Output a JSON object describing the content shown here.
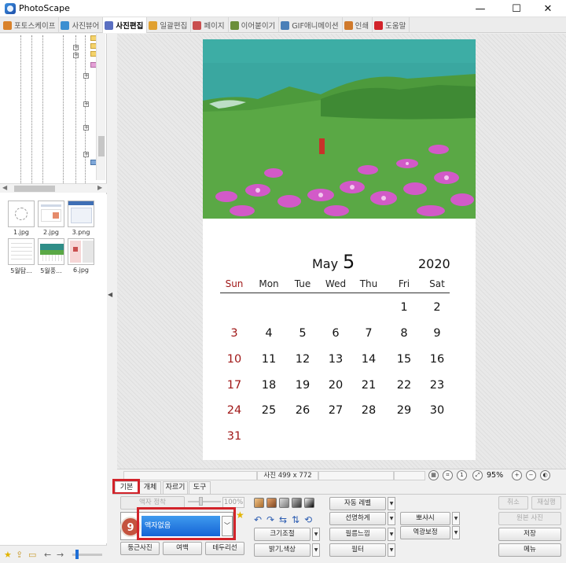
{
  "window": {
    "title": "PhotoScape",
    "controls": {
      "minimize": "—",
      "maximize": "☐",
      "close": "✕"
    }
  },
  "main_tabs": [
    {
      "label": "포토스케이프",
      "color": "#d9822b"
    },
    {
      "label": "사진뷰어",
      "color": "#3c8fd1"
    },
    {
      "label": "사진편집",
      "color": "#5a6fc2",
      "active": true
    },
    {
      "label": "일괄편집",
      "color": "#e0a030"
    },
    {
      "label": "페이지",
      "color": "#c94f4f"
    },
    {
      "label": "이어붙이기",
      "color": "#6b8e3a"
    },
    {
      "label": "GIF애니메이션",
      "color": "#4a7fb8"
    },
    {
      "label": "인쇄",
      "color": "#d07a2c"
    },
    {
      "label": "도움말",
      "color": "#d2232a"
    }
  ],
  "thumbnails": [
    {
      "caption": "1.jpg"
    },
    {
      "caption": "2.jpg"
    },
    {
      "caption": "3.png"
    },
    {
      "caption": "5월탐..."
    },
    {
      "caption": "5월풍..."
    },
    {
      "caption": "6.jpg"
    }
  ],
  "calendar": {
    "month": "May",
    "day": "5",
    "year": "2020",
    "weekdays": [
      "Sun",
      "Mon",
      "Tue",
      "Wed",
      "Thu",
      "Fri",
      "Sat"
    ],
    "weeks": [
      [
        "",
        "",
        "",
        "",
        "",
        "1",
        "2"
      ],
      [
        "3",
        "4",
        "5",
        "6",
        "7",
        "8",
        "9"
      ],
      [
        "10",
        "11",
        "12",
        "13",
        "14",
        "15",
        "16"
      ],
      [
        "17",
        "18",
        "19",
        "20",
        "21",
        "22",
        "23"
      ],
      [
        "24",
        "25",
        "26",
        "27",
        "28",
        "29",
        "30"
      ],
      [
        "31",
        "",
        "",
        "",
        "",
        "",
        ""
      ]
    ],
    "sunday_color": "#a01818"
  },
  "status": {
    "photo_size": "사진 499 x 772",
    "zoom": "95%"
  },
  "editor_tabs": [
    {
      "label": "기본",
      "active": true
    },
    {
      "label": "개체"
    },
    {
      "label": "자르기"
    },
    {
      "label": "도구"
    }
  ],
  "panel": {
    "frame_fit": "액자 정착",
    "frame_pct": "100%",
    "frame_selected": "액자없음",
    "badge": "9",
    "round_photo": "둥근사진",
    "margin": "여백",
    "border_line": "테두리선",
    "resize": "크기조절",
    "brightness": "밝기,색상",
    "auto_level": "자동 레벨",
    "sharpen": "선명하게",
    "film_effect": "필름느낌",
    "filter": "필터",
    "bloom": "뽀샤시",
    "backlight": "역광보정",
    "undo": "취소",
    "redo": "재실행",
    "original": "원본 사진",
    "save": "저장",
    "menu": "메뉴"
  },
  "accent_highlight": "#d2232a"
}
